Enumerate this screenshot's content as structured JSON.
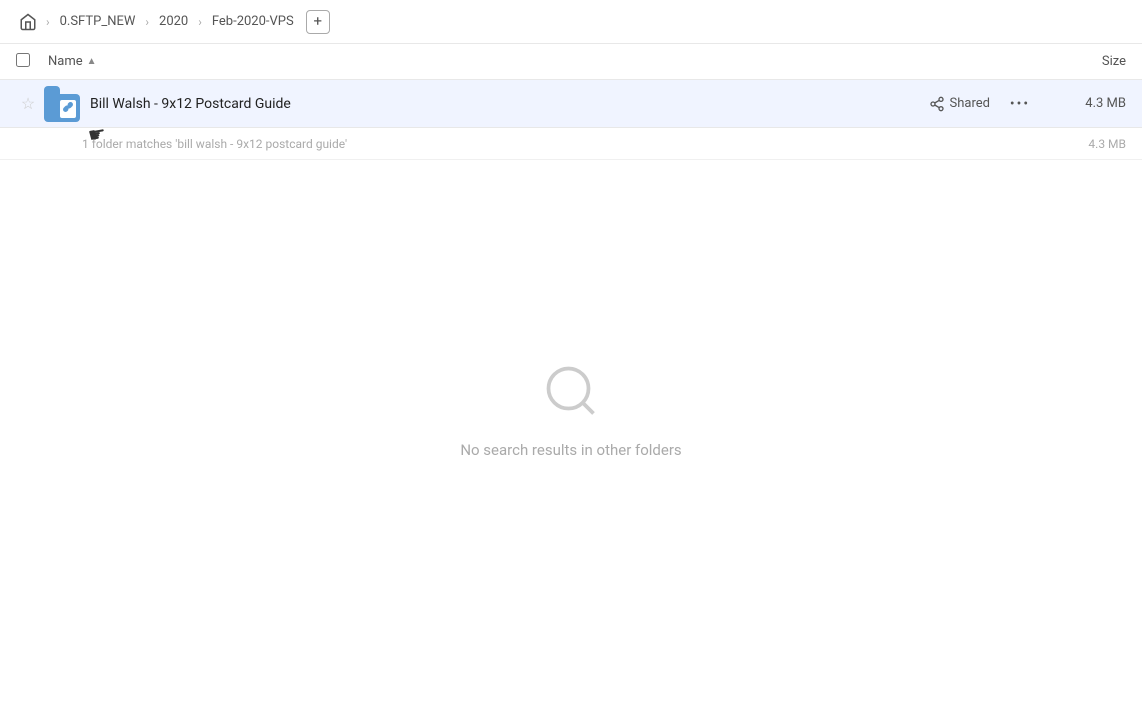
{
  "breadcrumb": {
    "home_label": "Home",
    "items": [
      {
        "label": "0.SFTP_NEW"
      },
      {
        "label": "2020"
      },
      {
        "label": "Feb-2020-VPS"
      }
    ],
    "add_button_label": "+"
  },
  "table": {
    "col_name_label": "Name",
    "col_size_label": "Size",
    "sort_direction": "asc"
  },
  "file_row": {
    "name": "Bill Walsh - 9x12 Postcard Guide",
    "shared_label": "Shared",
    "size": "4.3 MB",
    "more_label": "..."
  },
  "match_row": {
    "text": "1 folder matches 'bill walsh - 9x12 postcard guide'",
    "size": "4.3 MB"
  },
  "empty_section": {
    "no_results_text": "No search results in other folders"
  },
  "icons": {
    "home": "home-icon",
    "star": "★",
    "star_empty": "☆",
    "more": "···",
    "search": "search-icon",
    "share": "share-icon",
    "sort_asc": "▲"
  }
}
